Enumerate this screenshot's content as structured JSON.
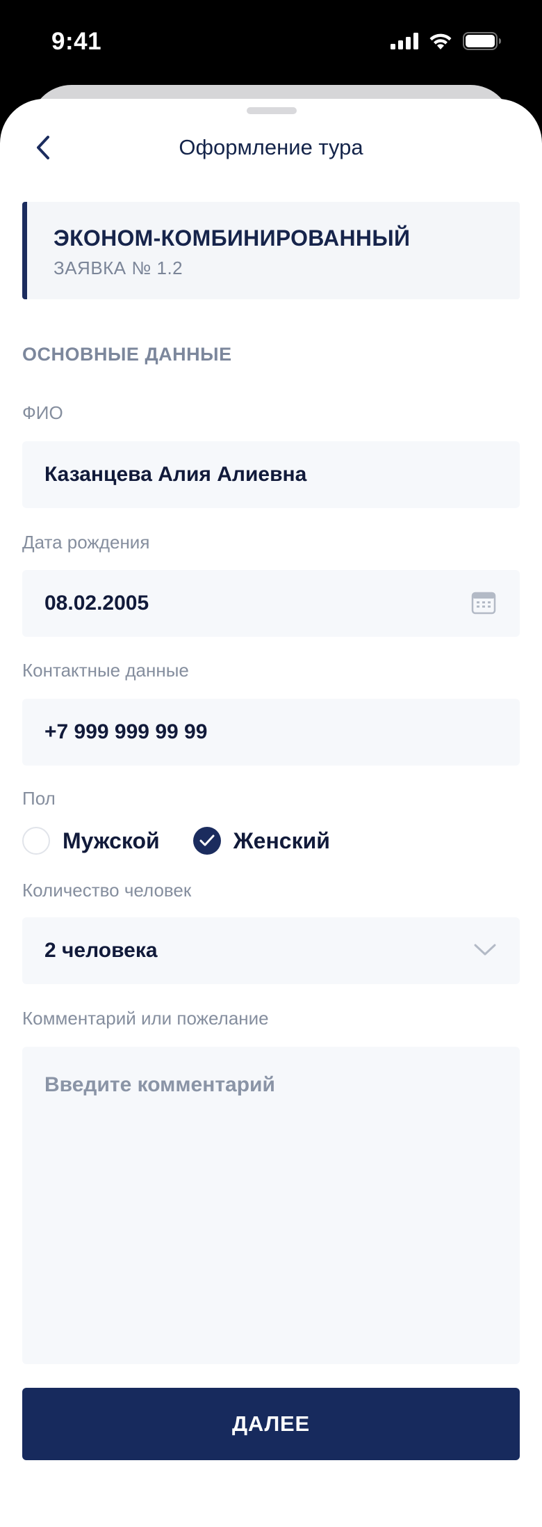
{
  "status_bar": {
    "time": "9:41",
    "icons": [
      "signal-icon",
      "wifi-icon",
      "battery-icon"
    ]
  },
  "header": {
    "title": "Оформление тура",
    "back_icon": "chevron-left-icon"
  },
  "tour": {
    "name": "ЭКОНОМ-КОМБИНИРОВАННЫЙ",
    "request": "ЗАЯВКА № 1.2"
  },
  "form": {
    "section_title": "ОСНОВНЫЕ ДАННЫЕ",
    "fio_label": "ФИО",
    "fio_value": "Казанцева Алия Алиевна",
    "birth_label": "Дата рождения",
    "birth_value": "08.02.2005",
    "contact_label": "Контактные данные",
    "contact_value": "+7 999 999 99 99",
    "gender_label": "Пол",
    "gender_options": [
      {
        "label": "Мужской",
        "checked": false
      },
      {
        "label": "Женский",
        "checked": true
      }
    ],
    "people_label": "Количество человек",
    "people_value": "2 человека",
    "comment_label": "Комментарий или пожелание",
    "comment_placeholder": "Введите комментарий"
  },
  "actions": {
    "next_label": "ДАЛЕЕ"
  },
  "colors": {
    "primary": "#172a5d",
    "text_dark": "#111a3a",
    "label_gray": "#858e9e",
    "field_bg": "#f6f8fb"
  }
}
